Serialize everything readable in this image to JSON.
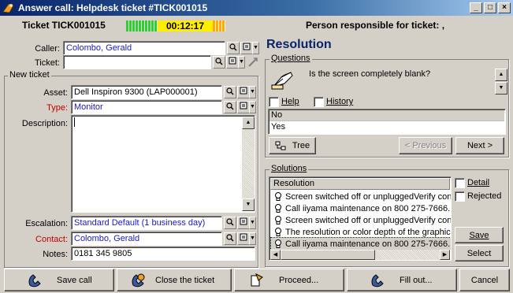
{
  "window": {
    "title": "Answer call: Helpdesk ticket #TICK001015",
    "minimize": "_",
    "maximize": "□",
    "close": "×"
  },
  "header": {
    "ticket_label": "Ticket TICK001015",
    "timer": "00:12:17",
    "responsible": "Person responsible for ticket: ,"
  },
  "caller": {
    "label": "Caller:",
    "value": "Colombo, Gerald"
  },
  "ticket": {
    "label": "Ticket:",
    "value": ""
  },
  "new_ticket": {
    "group_label": "New ticket",
    "asset_label": "Asset:",
    "asset_value": "Dell Inspiron 9300 (LAP000001)",
    "type_label": "Type:",
    "type_value": "Monitor",
    "description_label": "Description:",
    "description_value": "",
    "escalation_label": "Escalation:",
    "escalation_value": "Standard Default (1 business day)",
    "contact_label": "Contact:",
    "contact_value": "Colombo, Gerald",
    "notes_label": "Notes:",
    "notes_value": "0181 345 9805"
  },
  "resolution": {
    "heading": "Resolution",
    "questions_group": "Questions",
    "question_text": "Is the screen completely blank?",
    "help_label": "Help",
    "history_label": "History",
    "answers": [
      "No",
      "Yes"
    ],
    "tree_button": "Tree",
    "previous_button": "< Previous",
    "next_button": "Next >",
    "solutions_group": "Solutions",
    "solutions_column": "Resolution",
    "solutions": [
      "Screen switched off or unpluggedVerify con...",
      "Call iiyama maintenance on 800 275-7666.",
      "Screen switched off or unpluggedVerify con...",
      "The resolution or color depth of the graphics...",
      "Call iiyama maintenance on 800 275-7666."
    ],
    "detail_label": "Detail",
    "rejected_label": "Rejected",
    "save_button": "Save",
    "select_button": "Select"
  },
  "footer": {
    "save_call": "Save call",
    "close_ticket": "Close the ticket",
    "proceed": "Proceed...",
    "fill_out": "Fill out...",
    "cancel": "Cancel"
  },
  "colors": {
    "title_bar": "#0a246a",
    "field_link_text": "#1a1ac0",
    "required_label": "#c00000",
    "timer_green": "#33cc33",
    "timer_yellow": "#ffee00"
  }
}
